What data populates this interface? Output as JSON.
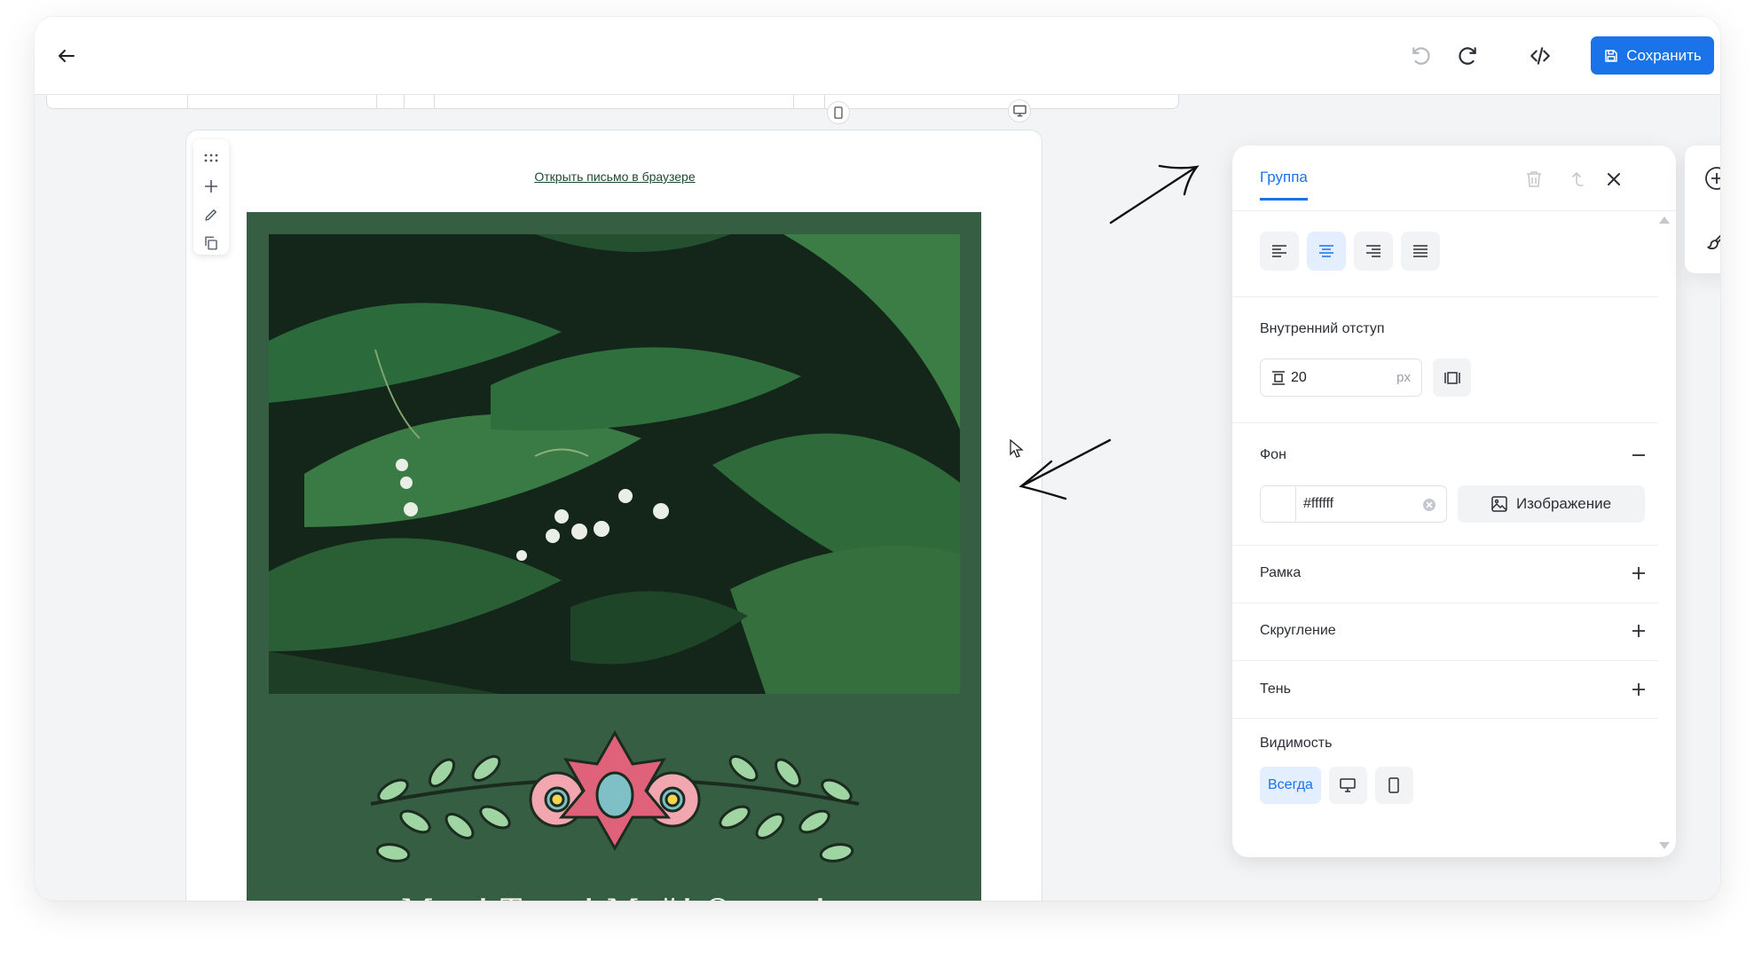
{
  "toolbar": {
    "back_icon": "arrow-left-icon",
    "undo_icon": "undo-icon",
    "redo_icon": "redo-icon",
    "code_icon": "code-icon",
    "save_label": "Сохранить",
    "save_icon": "floppy-disk-icon"
  },
  "canvas": {
    "browser_link": "Открыть письмо в браузере",
    "headline": "Мир! Труд! Май! Отдых!",
    "block_tools": [
      "drag-handle-icon",
      "plus-icon",
      "pencil-icon",
      "copy-icon"
    ]
  },
  "panel": {
    "tab_label": "Группа",
    "alignment": {
      "options": [
        "left",
        "center",
        "right",
        "justify"
      ],
      "selected": "center"
    },
    "padding": {
      "label": "Внутренний отступ",
      "value": "20",
      "unit": "px"
    },
    "background": {
      "label": "Фон",
      "color_value": "#ffffff",
      "image_button": "Изображение"
    },
    "border": {
      "label": "Рамка"
    },
    "radius": {
      "label": "Скругление"
    },
    "shadow": {
      "label": "Тень"
    },
    "visibility": {
      "label": "Видимость",
      "always_label": "Всегда",
      "selected": "always"
    }
  },
  "colors": {
    "accent": "#1a73e8",
    "email_background": "#355e43",
    "canvas_background": "#f3f4f6"
  }
}
